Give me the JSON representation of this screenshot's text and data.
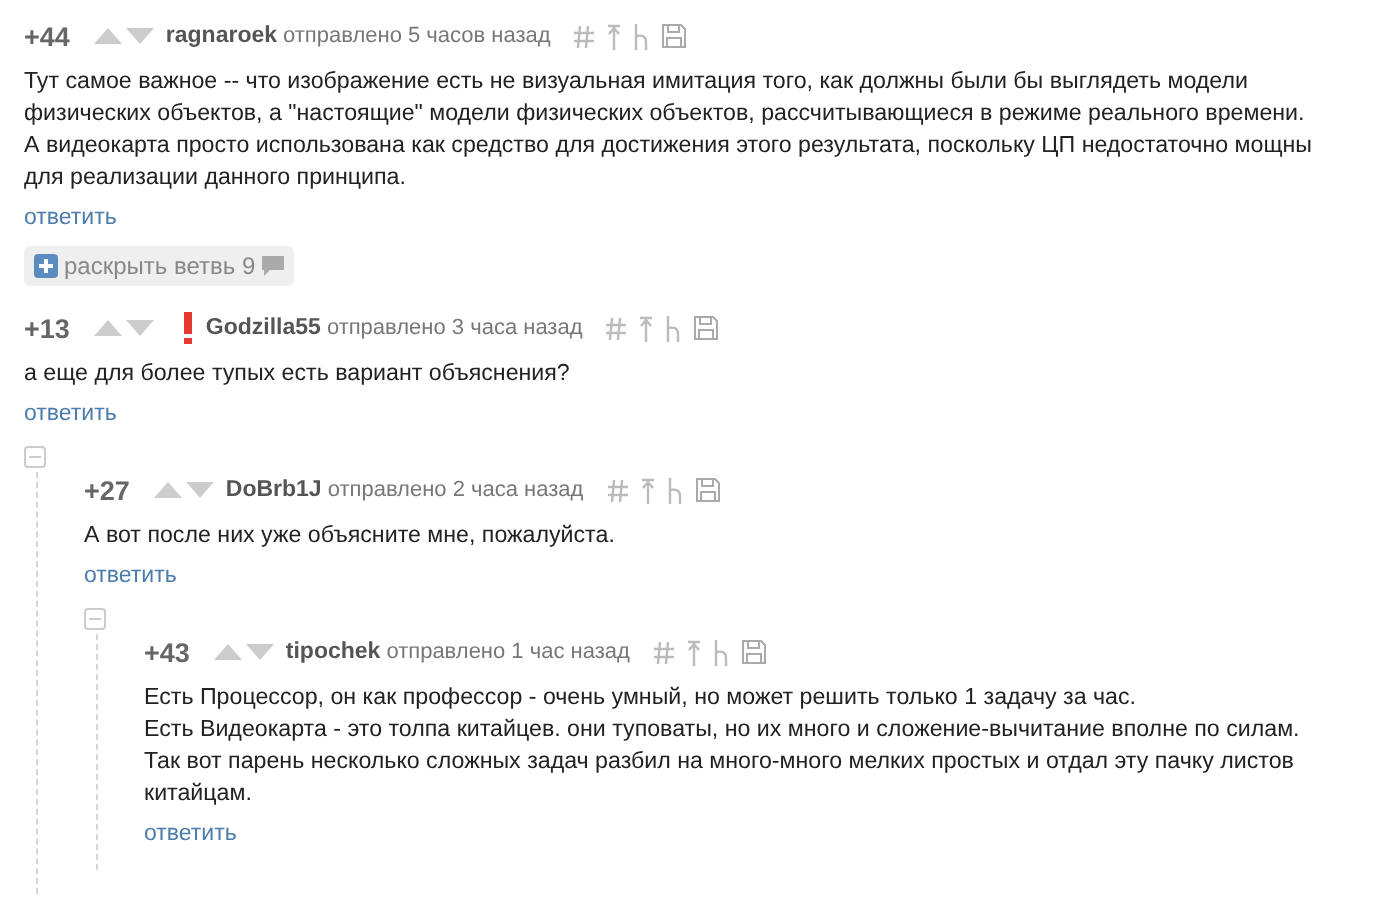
{
  "comments": [
    {
      "score": "+44",
      "author": "ragnaroek",
      "time": "отправлено 5 часов назад",
      "flagged": false,
      "body": "Тут самое важное -- что изображение есть не визуальная имитация того, как должны были бы выглядеть модели\nфизических объектов, а \"настоящие\" модели физических объектов, рассчитывающиеся в режиме реального времени.\nА видеокарта просто использована как средство для достижения этого результата, поскольку ЦП недостаточно мощны\nдля реализации данного принципа.",
      "reply": "ответить",
      "expand": "раскрыть ветвь 9"
    },
    {
      "score": "+13",
      "author": "Godzilla55",
      "time": "отправлено 3 часа назад",
      "flagged": true,
      "body": "а еще для более тупых есть вариант объяснения?",
      "reply": "ответить",
      "children": [
        {
          "score": "+27",
          "author": "DoBrb1J",
          "time": "отправлено 2 часа назад",
          "flagged": false,
          "body": "А вот после них уже объясните мне, пожалуйста.",
          "reply": "ответить",
          "children": [
            {
              "score": "+43",
              "author": "tipochek",
              "time": "отправлено 1 час назад",
              "flagged": false,
              "body": "Есть Процессор, он как профессор - очень умный, но может решить только 1 задачу за час.\nЕсть Видеокарта - это толпа китайцев. они туповаты, но их много и сложение-вычитание вполне по силам.\nТак вот парень несколько сложных задач разбил на много-много мелких простых и отдал эту пачку листов\nкитайцам.",
              "reply": "ответить"
            }
          ]
        }
      ]
    }
  ]
}
